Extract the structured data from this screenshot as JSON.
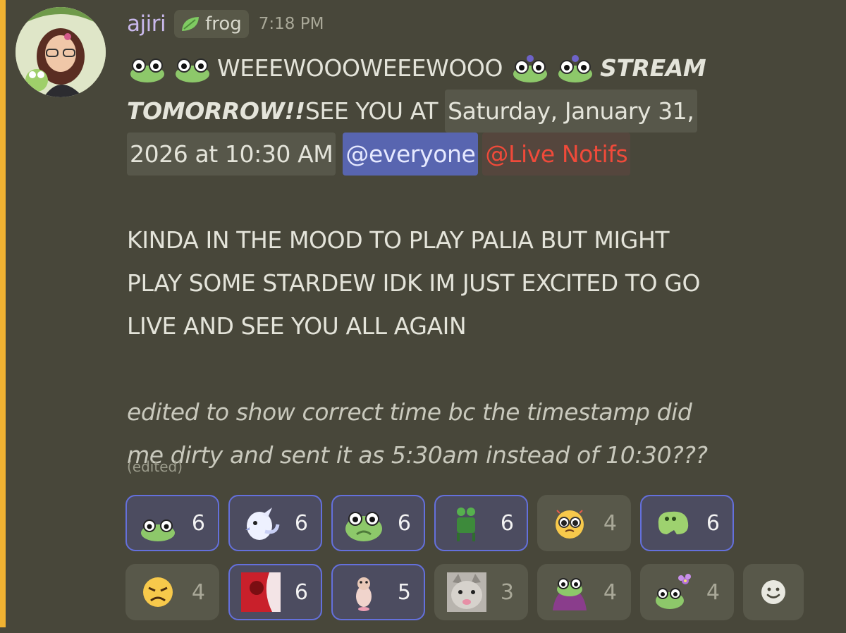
{
  "message": {
    "author": "ajiri",
    "tag": {
      "icon": "leaf-icon",
      "label": "frog"
    },
    "timestamp": "7:18 PM",
    "line1_text": "WEEEWOOOWEEEWOOO",
    "line1_bold": "STREAM",
    "line2_bold": "TOMORROW!!",
    "line2_text": "SEE YOU AT",
    "line2_time": "Saturday, January 31,",
    "line3_time": "2026 at 10:30 AM",
    "mention_everyone": "@everyone",
    "mention_role": "@Live Notifs",
    "body": [
      "KINDA IN THE MOOD TO PLAY PALIA BUT MIGHT",
      "PLAY SOME STARDEW IDK IM JUST EXCITED TO GO",
      "LIVE AND SEE YOU ALL AGAIN"
    ],
    "italic": [
      "edited to show correct time bc the timestamp did",
      "me dirty and sent it as 5:30am instead of 10:30???"
    ],
    "edited_label": "(edited)"
  },
  "reactions": [
    {
      "emoji": "frog-peek-icon",
      "count": "6",
      "active": true
    },
    {
      "emoji": "cockatiel-icon",
      "count": "6",
      "active": true
    },
    {
      "emoji": "frog-face-icon",
      "count": "6",
      "active": true
    },
    {
      "emoji": "frog-chair-icon",
      "count": "6",
      "active": true
    },
    {
      "emoji": "pleading-face-icon",
      "count": "4",
      "active": false
    },
    {
      "emoji": "green-blob-icon",
      "count": "6",
      "active": true
    },
    {
      "emoji": "tired-face-icon",
      "count": "4",
      "active": false
    },
    {
      "emoji": "red-photo-icon",
      "count": "6",
      "active": true
    },
    {
      "emoji": "hamster-icon",
      "count": "5",
      "active": true
    },
    {
      "emoji": "cat-face-icon",
      "count": "3",
      "active": false
    },
    {
      "emoji": "frog-blanket-icon",
      "count": "4",
      "active": false
    },
    {
      "emoji": "frog-flower-icon",
      "count": "4",
      "active": false
    }
  ],
  "colors": {
    "accent": "#f0b232",
    "mention": "#5865b0",
    "role": "#f04a3a",
    "username": "#c9b8ec"
  }
}
